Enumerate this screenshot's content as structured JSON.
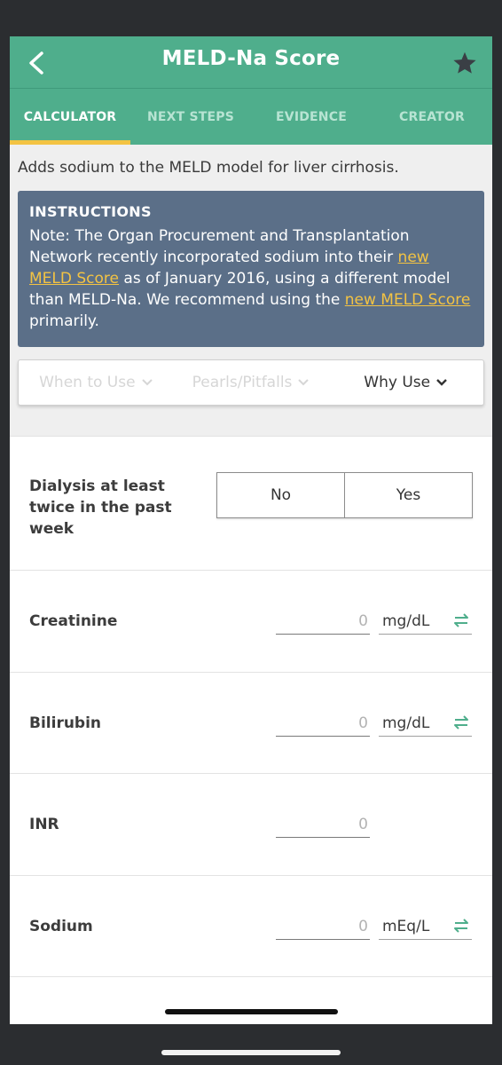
{
  "header": {
    "title": "MELD-Na Score",
    "back_icon": "chevron-left-icon",
    "favorite_icon": "star-icon"
  },
  "tabs": [
    {
      "label": "CALCULATOR",
      "active": true
    },
    {
      "label": "NEXT STEPS",
      "active": false
    },
    {
      "label": "EVIDENCE",
      "active": false
    },
    {
      "label": "CREATOR",
      "active": false
    }
  ],
  "description": "Adds sodium to the MELD model for liver cirrhosis.",
  "instructions": {
    "title": "INSTRUCTIONS",
    "text_1": "Note: The Organ Procurement and Transplantation Network recently incorporated sodium into their ",
    "link_1": "new MELD Score",
    "text_2": " as of January 2016, using a different model than MELD-Na. We recommend using the ",
    "link_2": "new MELD Score",
    "text_3": " primarily."
  },
  "accordion": [
    {
      "label": "When to Use",
      "enabled": false
    },
    {
      "label": "Pearls/Pitfalls",
      "enabled": false
    },
    {
      "label": "Why Use",
      "enabled": true
    }
  ],
  "dialysis": {
    "label": "Dialysis at least twice in the past week",
    "options": [
      "No",
      "Yes"
    ]
  },
  "fields": [
    {
      "label": "Creatinine",
      "value": "0",
      "unit": "mg/dL",
      "convertible": true
    },
    {
      "label": "Bilirubin",
      "value": "0",
      "unit": "mg/dL",
      "convertible": true
    },
    {
      "label": "INR",
      "value": "0",
      "unit": "",
      "convertible": false
    },
    {
      "label": "Sodium",
      "value": "0",
      "unit": "mEq/L",
      "convertible": true
    }
  ],
  "colors": {
    "brand_green": "#4fae8c",
    "tab_indicator": "#f3c343",
    "instructions_bg": "#5b6f88",
    "link": "#f3c343",
    "swap_icon": "#4fae8c"
  }
}
